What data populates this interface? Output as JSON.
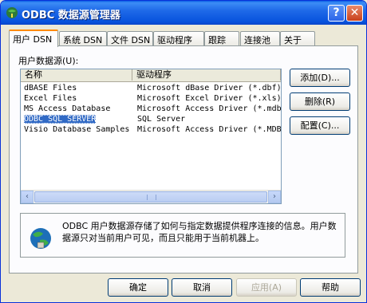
{
  "window": {
    "title": "ODBC 数据源管理器"
  },
  "titlebar": {
    "help": "?",
    "close": "✕"
  },
  "tabs": [
    {
      "label": "用户 DSN"
    },
    {
      "label": "系统 DSN"
    },
    {
      "label": "文件 DSN"
    },
    {
      "label": "驱动程序"
    },
    {
      "label": "跟踪"
    },
    {
      "label": "连接池"
    },
    {
      "label": "关于"
    }
  ],
  "datasources": {
    "label": "用户数据源(U):",
    "columns": [
      "名称",
      "驱动程序"
    ],
    "rows": [
      {
        "name": "dBASE Files",
        "driver": "Microsoft dBase Driver (*.dbf)"
      },
      {
        "name": "Excel Files",
        "driver": "Microsoft Excel Driver (*.xls)"
      },
      {
        "name": "MS Access Database",
        "driver": "Microsoft Access Driver (*.mdb)"
      },
      {
        "name": "ODBC_SQL_SERVER",
        "driver": "SQL Server"
      },
      {
        "name": "Visio Database Samples",
        "driver": "Microsoft Access Driver (*.MDB)"
      }
    ],
    "selected_index": 3
  },
  "side_buttons": {
    "add": "添加(D)...",
    "remove": "删除(R)",
    "configure": "配置(C)..."
  },
  "info": {
    "text": "ODBC 用户数据源存储了如何与指定数据提供程序连接的信息。用户数据源只对当前用户可见，而且只能用于当前机器上。"
  },
  "footer": {
    "ok": "确定",
    "cancel": "取消",
    "apply": "应用(A)",
    "help": "帮助"
  },
  "scrollbar": {
    "left": "‹",
    "right": "›"
  }
}
